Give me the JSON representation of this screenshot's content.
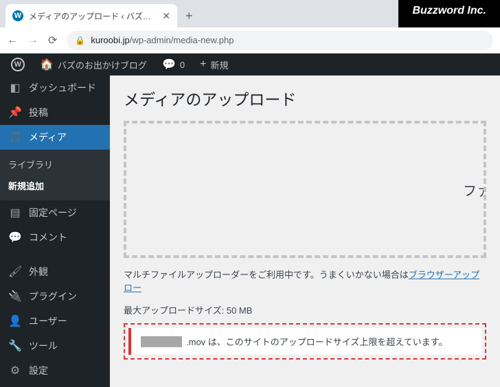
{
  "browser": {
    "tab_title": "メディアのアップロード ‹ バズのお出かけ",
    "corp": "Buzzword Inc.",
    "url_host": "kuroobi.jp",
    "url_path": "/wp-admin/media-new.php"
  },
  "adminbar": {
    "site_name": "バズのお出かけブログ",
    "comments_count": "0",
    "new_label": "新規"
  },
  "sidebar": {
    "dashboard": "ダッシュボード",
    "posts": "投稿",
    "media": "メディア",
    "media_sub": {
      "library": "ライブラリ",
      "add_new": "新規追加"
    },
    "pages": "固定ページ",
    "comments": "コメント",
    "appearance": "外観",
    "plugins": "プラグイン",
    "users": "ユーザー",
    "tools": "ツール",
    "settings": "設定"
  },
  "page": {
    "title": "メディアのアップロード",
    "dropzone_hint": "ファ",
    "multi_note_pre": "マルチファイルアップローダーをご利用中です。うまくいかない場合は",
    "multi_note_link": "ブラウザーアップロー",
    "max_label": "最大アップロードサイズ: 50 MB",
    "error_suffix": ".mov は、このサイトのアップロードサイズ上限を超えています。"
  }
}
